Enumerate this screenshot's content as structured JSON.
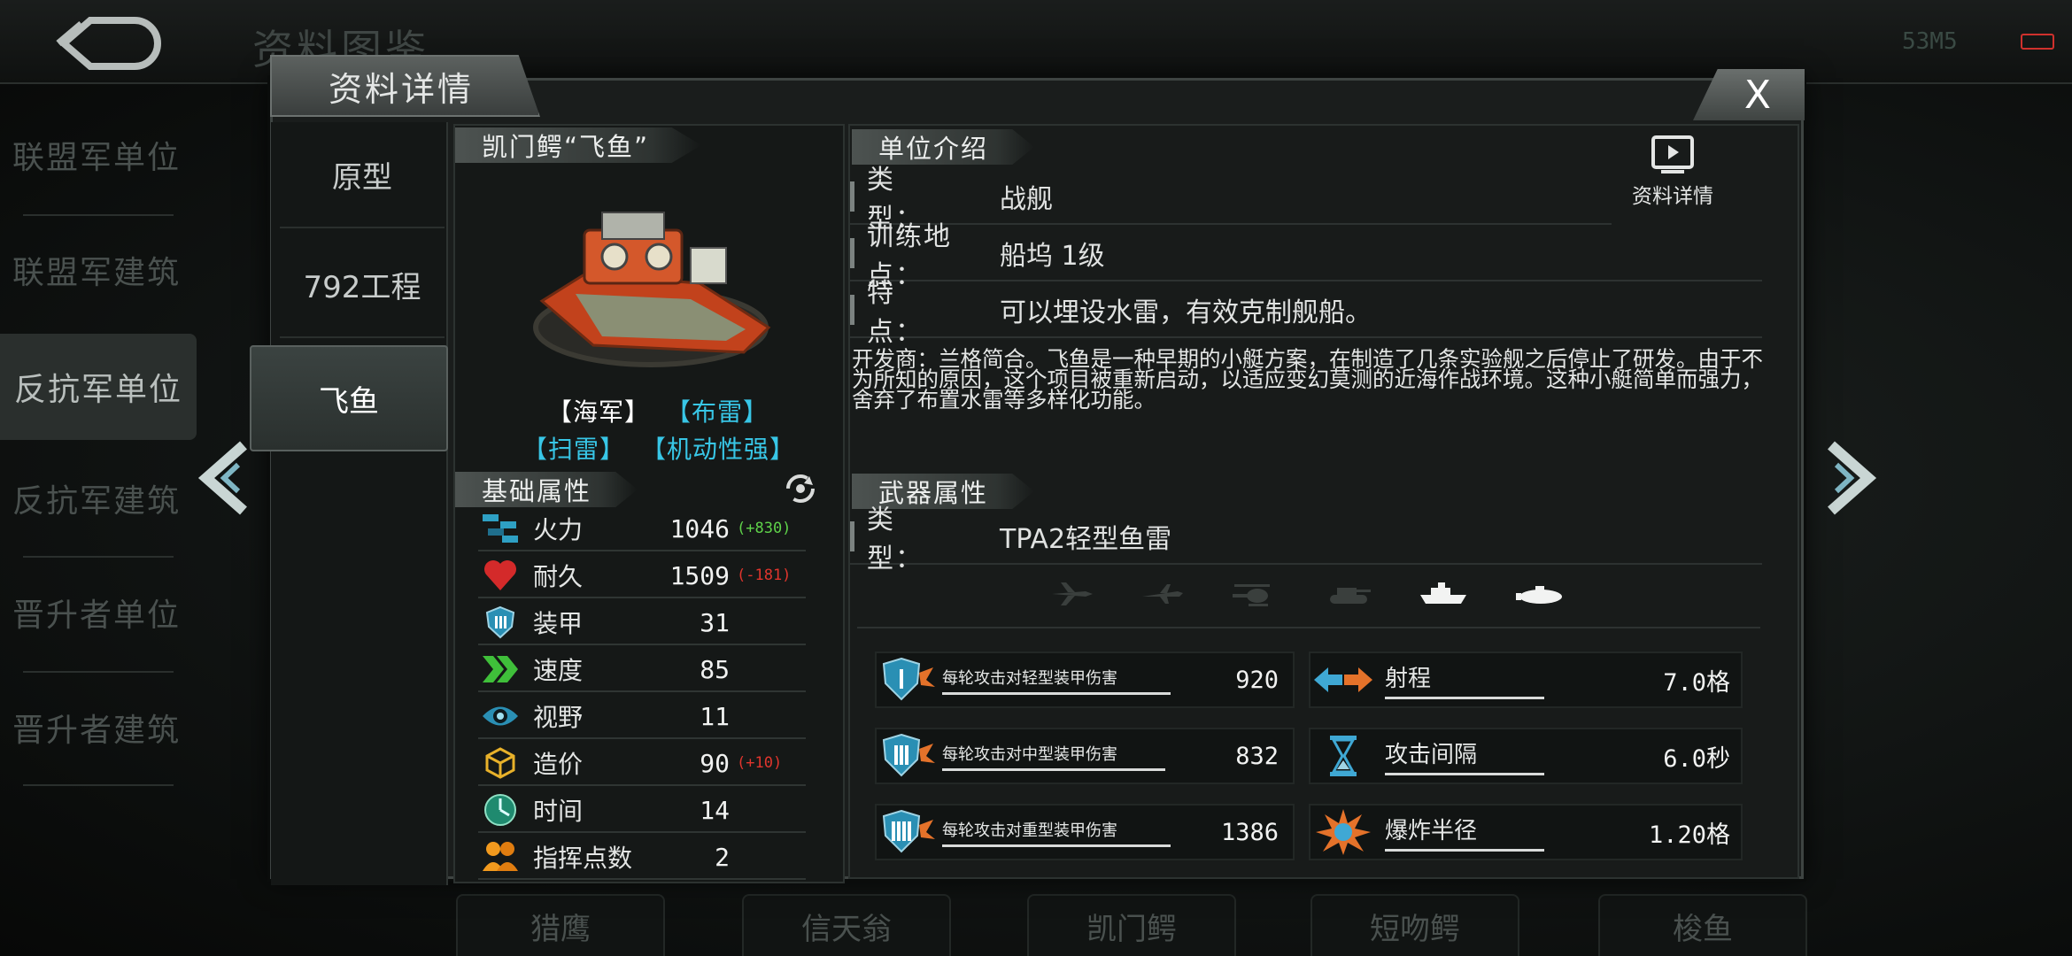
{
  "header": {
    "title": "资料图鉴",
    "status": "53M5"
  },
  "left_nav": [
    {
      "label": "联盟军单位",
      "active": false
    },
    {
      "label": "联盟军建筑",
      "active": false
    },
    {
      "label": "反抗军单位",
      "active": true
    },
    {
      "label": "反抗军建筑",
      "active": false
    },
    {
      "label": "晋升者单位",
      "active": false
    },
    {
      "label": "晋升者建筑",
      "active": false
    }
  ],
  "bottom_nav": [
    "猎鹰",
    "信天翁",
    "凯门鳄",
    "短吻鳄",
    "梭鱼"
  ],
  "dialog": {
    "tab_label": "资料详情",
    "close_label": "X",
    "variant_tabs": [
      {
        "label": "原型"
      },
      {
        "label": "792工程"
      },
      {
        "label": "飞鱼"
      }
    ],
    "unit": {
      "name": "凯门鳄“飞鱼”",
      "tags": [
        "【海军】",
        "【布雷】",
        "【扫雷】",
        "【机动性强】"
      ]
    },
    "base_attrs": {
      "header": "基础属性",
      "rows": [
        {
          "label": "火力",
          "value": "1046",
          "bonus": "(+830)"
        },
        {
          "label": "耐久",
          "value": "1509",
          "bonus": "(-181)"
        },
        {
          "label": "装甲",
          "value": "31",
          "bonus": ""
        },
        {
          "label": "速度",
          "value": "85",
          "bonus": ""
        },
        {
          "label": "视野",
          "value": "11",
          "bonus": ""
        },
        {
          "label": "造价",
          "value": "90",
          "bonus": "(+10)"
        },
        {
          "label": "时间",
          "value": "14",
          "bonus": ""
        },
        {
          "label": "指挥点数",
          "value": "2",
          "bonus": ""
        }
      ]
    },
    "unit_intro": {
      "header": "单位介绍",
      "detail_label": "资料详情",
      "rows": [
        {
          "key": "类　　型：",
          "value": "战舰"
        },
        {
          "key": "训练地点：",
          "value": "船坞 1级"
        },
        {
          "key": "特　　点：",
          "value": "可以埋设水雷，有效克制舰船。"
        }
      ],
      "description": "开发商：兰格简合。飞鱼是一种早期的小艇方案，在制造了几条实验舰之后停止了研发。由于不为所知的原因，这个项目被重新启动，以适应变幻莫测的近海作战环境。这种小艇简单而强力，舍弃了布置水雷等多样化功能。"
    },
    "weapon": {
      "header": "武器属性",
      "type_key": "类　　型：",
      "type_value": "TPA2轻型鱼雷",
      "targets": [
        {
          "icon": "fighter-jet-icon",
          "active": false
        },
        {
          "icon": "airplane-icon",
          "active": false
        },
        {
          "icon": "helicopter-icon",
          "active": false
        },
        {
          "icon": "tank-icon",
          "active": false
        },
        {
          "icon": "ship-icon",
          "active": true
        },
        {
          "icon": "submarine-icon",
          "active": true
        }
      ],
      "stats": [
        {
          "label": "每轮攻击对轻型装甲伤害",
          "value": "920"
        },
        {
          "label": "射程",
          "value": "7.0格"
        },
        {
          "label": "每轮攻击对中型装甲伤害",
          "value": "832"
        },
        {
          "label": "攻击间隔",
          "value": "6.0秒"
        },
        {
          "label": "每轮攻击对重型装甲伤害",
          "value": "1386"
        },
        {
          "label": "爆炸半径",
          "value": "1.20格"
        }
      ]
    }
  },
  "colors": {
    "tag_white": "#ffffff",
    "tag_cyan": "#38c6e6",
    "bonus_green": "#5fd34a",
    "bonus_red": "#e0352d",
    "accent_gold": "#e8b12a"
  }
}
